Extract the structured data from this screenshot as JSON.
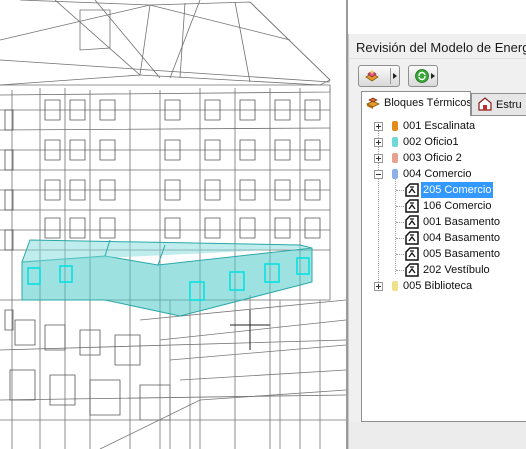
{
  "palette": {
    "title": "Revisión del Modelo de Energét",
    "toolbar": [
      {
        "icon": "energy-model-icon"
      },
      {
        "icon": "refresh-green-icon"
      }
    ],
    "tabs": [
      {
        "label": "Bloques Térmicos",
        "icon": "thermal-blocks-icon",
        "active": true
      },
      {
        "label": "Estru",
        "icon": "structures-icon",
        "active": false
      }
    ],
    "tree": [
      {
        "label": "001 Escalinata",
        "color": "#e38b1c",
        "expanded": false
      },
      {
        "label": "002 Oficio1",
        "color": "#6fd8d8",
        "expanded": false
      },
      {
        "label": "003 Oficio 2",
        "color": "#e8a090",
        "expanded": false
      },
      {
        "label": "004 Comercio",
        "color": "#8fb0e6",
        "expanded": true,
        "children": [
          {
            "label": "205 Comercio",
            "selected": true
          },
          {
            "label": "106 Comercio"
          },
          {
            "label": "001 Basamento"
          },
          {
            "label": "004 Basamento"
          },
          {
            "label": "005 Basamento"
          },
          {
            "label": "202 Vestíbulo"
          }
        ]
      },
      {
        "label": "005 Biblioteca",
        "color": "#efe08a",
        "expanded": false
      }
    ]
  },
  "viewport": {
    "highlight_color": "#4ec8c8",
    "wire_color": "#6a6a6a"
  }
}
